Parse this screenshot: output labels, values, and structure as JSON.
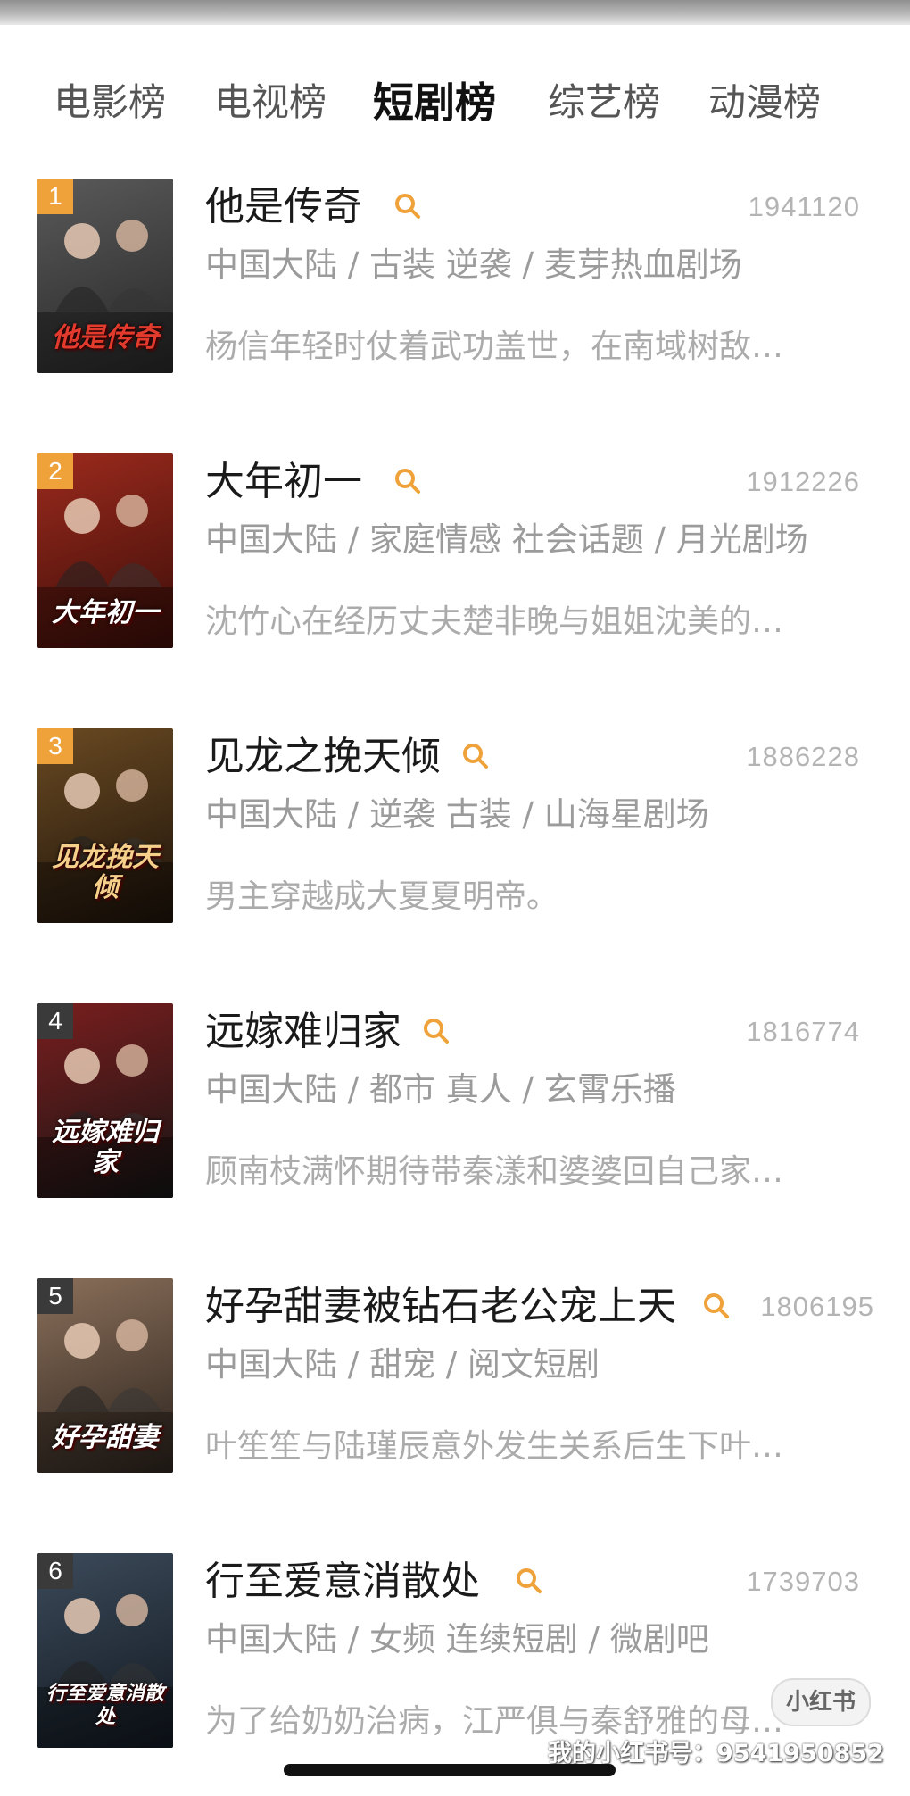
{
  "tabs": [
    {
      "label": "电影榜",
      "active": false
    },
    {
      "label": "电视榜",
      "active": false
    },
    {
      "label": "短剧榜",
      "active": true
    },
    {
      "label": "综艺榜",
      "active": false
    },
    {
      "label": "动漫榜",
      "active": false
    }
  ],
  "items": [
    {
      "rank": "1",
      "title": "他是传奇",
      "views": "1941120",
      "meta": "中国大陆 / 古装 逆袭 / 麦芽热血剧场",
      "desc": "杨信年轻时仗着武功盖世，在南域树敌…",
      "poster_text": "他是传奇",
      "rank_color": "#f0a23a",
      "poster_bg": [
        "#5a5a5a",
        "#262626"
      ],
      "text_color": "#e23b2e"
    },
    {
      "rank": "2",
      "title": "大年初一",
      "views": "1912226",
      "meta": "中国大陆 / 家庭情感 社会话题 / 月光剧场",
      "desc": "沈竹心在经历丈夫楚非晚与姐姐沈美的…",
      "poster_text": "大年初一",
      "rank_color": "#f0a23a",
      "poster_bg": [
        "#9c2a1d",
        "#3a0d08"
      ],
      "text_color": "#ffffff"
    },
    {
      "rank": "3",
      "title": "见龙之挽天倾",
      "views": "1886228",
      "meta": "中国大陆 / 逆袭 古装 / 山海星剧场",
      "desc": "男主穿越成大夏夏明帝。",
      "poster_text": "见龙挽天倾",
      "rank_color": "#f0a23a",
      "poster_bg": [
        "#6a4a22",
        "#1c120a"
      ],
      "text_color": "#f6d08a"
    },
    {
      "rank": "4",
      "title": "远嫁难归家",
      "views": "1816774",
      "meta": "中国大陆 / 都市 真人 / 玄霄乐播",
      "desc": "顾南枝满怀期待带秦漾和婆婆回自己家…",
      "poster_text": "远嫁难归家",
      "rank_color": "#3a3a3a",
      "poster_bg": [
        "#7a1e1e",
        "#141414"
      ],
      "text_color": "#ffffff"
    },
    {
      "rank": "5",
      "title": "好孕甜妻被钻石老公宠上天",
      "views": "1806195",
      "meta": "中国大陆 / 甜宠 / 阅文短剧",
      "desc": "叶笙笙与陆瑾辰意外发生关系后生下叶…",
      "poster_text": "好孕甜妻",
      "rank_color": "#3a3a3a",
      "poster_bg": [
        "#8a6f5a",
        "#2c231d"
      ],
      "text_color": "#ffffff"
    },
    {
      "rank": "6",
      "title": "行至爱意消散处",
      "views": "1739703",
      "meta": "中国大陆 / 女频 连续短剧 / 微剧吧",
      "desc": "为了给奶奶治病，江严俱与秦舒雅的母…",
      "poster_text": "行至爱意消散处",
      "rank_color": "#3a3a3a",
      "poster_bg": [
        "#3c4a5a",
        "#111820"
      ],
      "text_color": "#ffffff"
    }
  ],
  "badge": "小红书",
  "watermark": "我的小红书号：9541950852",
  "colors": {
    "search_icon": "#f0a23a",
    "views": "#b4b4b4",
    "meta": "#9b9b9b",
    "desc": "#ababab"
  }
}
